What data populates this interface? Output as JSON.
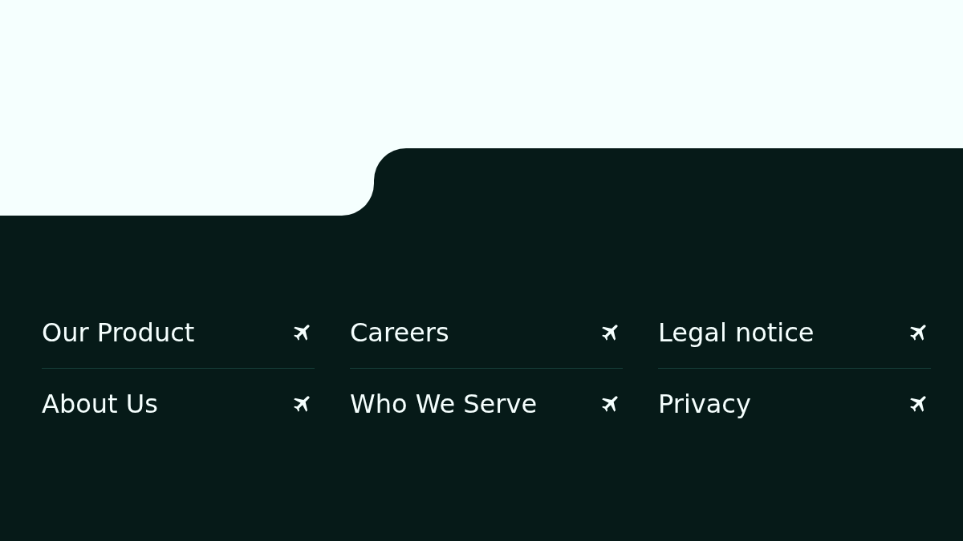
{
  "footer": {
    "columns": [
      {
        "links": [
          {
            "label": "Our Product"
          },
          {
            "label": "About Us"
          }
        ]
      },
      {
        "links": [
          {
            "label": "Careers"
          },
          {
            "label": "Who We Serve"
          }
        ]
      },
      {
        "links": [
          {
            "label": "Legal notice"
          },
          {
            "label": "Privacy"
          }
        ]
      }
    ]
  }
}
